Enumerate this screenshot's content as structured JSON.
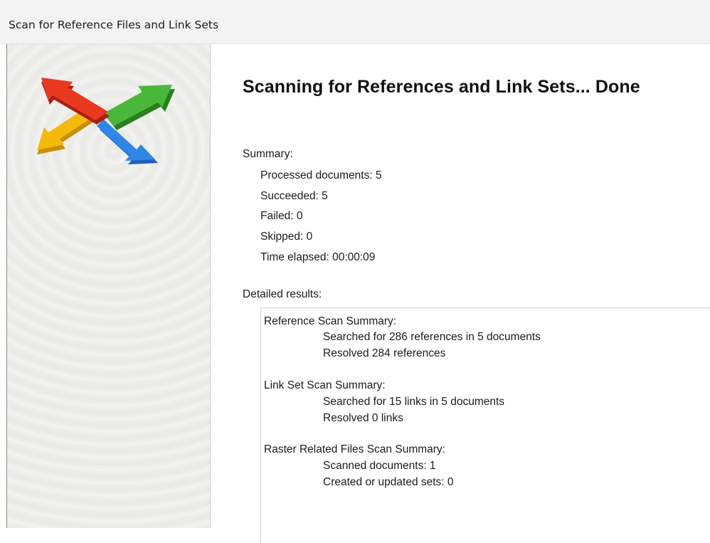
{
  "window": {
    "title": "Scan for Reference Files and Link Sets"
  },
  "logo": {
    "icon": "four-way-arrows-icon",
    "colors": {
      "red": "#e0301e",
      "green": "#3aa62c",
      "yellow": "#f2b705",
      "blue": "#1f6fd6"
    }
  },
  "main": {
    "heading": "Scanning for References and Link Sets... Done",
    "summary_label": "Summary:",
    "summary": {
      "processed": "Processed documents: 5",
      "succeeded": "Succeeded: 5",
      "failed": "Failed: 0",
      "skipped": "Skipped: 0",
      "time": "Time elapsed: 00:00:09"
    },
    "detailed_label": "Detailed results:"
  },
  "results": {
    "reference_header": "Reference Scan Summary:",
    "reference_searched": "Searched for 286 references in 5 documents",
    "reference_resolved": "Resolved 284 references",
    "linkset_header": "Link Set Scan Summary:",
    "linkset_searched": "Searched for 15 links in 5 documents",
    "linkset_resolved": "Resolved 0 links",
    "raster_header": "Raster Related Files Scan Summary:",
    "raster_scanned": "Scanned documents: 1",
    "raster_created": "Created or updated sets: 0"
  }
}
